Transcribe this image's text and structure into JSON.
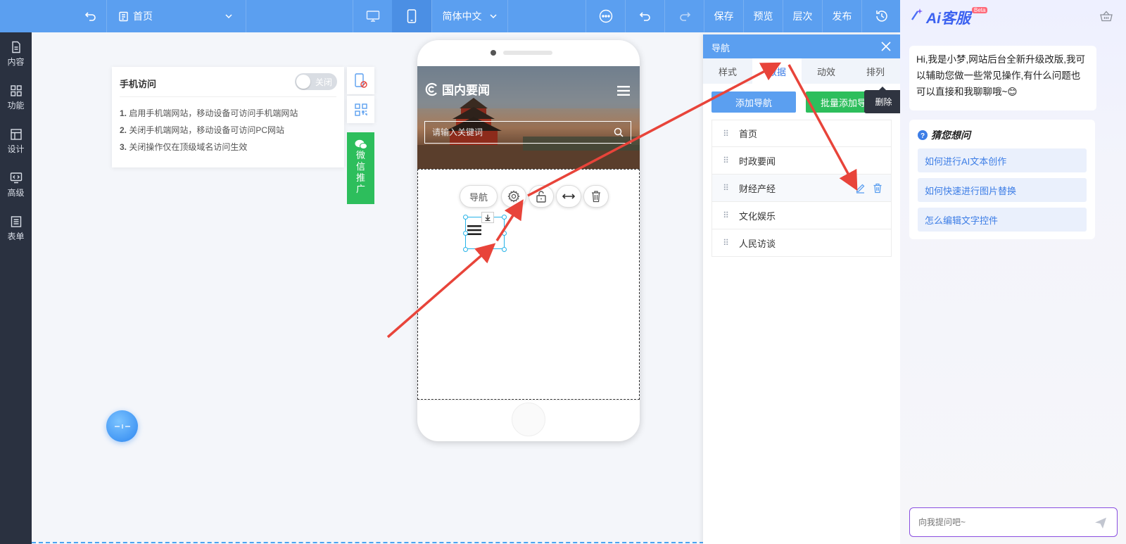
{
  "topbar": {
    "page_select": "首页",
    "language": "简体中文",
    "actions": [
      "保存",
      "预览",
      "层次",
      "发布"
    ]
  },
  "sidebar": {
    "items": [
      "内容",
      "功能",
      "设计",
      "高级",
      "表单"
    ]
  },
  "mobile_card": {
    "title": "手机访问",
    "toggle_label": "关闭",
    "toggle_state": "off",
    "lines": [
      {
        "num": "1.",
        "text": "启用手机端网站，移动设备可访问手机端网站"
      },
      {
        "num": "2.",
        "text": "关闭手机端网站，移动设备可访问PC网站"
      },
      {
        "num": "3.",
        "text": "关闭操作仅在顶级域名访问生效"
      }
    ]
  },
  "wechat": {
    "chars": [
      "微",
      "信",
      "推",
      "广"
    ],
    "color": "#2dbe5c"
  },
  "phone": {
    "site_title": "国内要闻",
    "search_placeholder": "请输入关键词",
    "component_toolbar": {
      "label": "导航"
    }
  },
  "panel": {
    "title": "导航",
    "tabs": [
      "样式",
      "数据",
      "动效",
      "排列"
    ],
    "active_tab": "数据",
    "add_button": "添加导航",
    "batch_button": "批量添加导航",
    "tooltip": "删除",
    "nav_items": [
      "首页",
      "时政要闻",
      "财经产经",
      "文化娱乐",
      "人民访谈"
    ]
  },
  "ai": {
    "brand": "Ai客服",
    "badge": "Beta",
    "greeting": "Hi,我是小梦,网站后台全新升级改版,我可以辅助您做一些常见操作,有什么问题也可以直接和我聊聊哦~😊",
    "guess_title": "猜您想问",
    "suggestions": [
      "如何进行AI文本创作",
      "如何快速进行图片替换",
      "怎么编辑文字控件"
    ],
    "input_placeholder": "向我提问吧~"
  },
  "colors": {
    "accent": "#5b9ff0",
    "green": "#2dbe5c",
    "arrow": "#e8443a",
    "sidebar": "#2a3140"
  }
}
